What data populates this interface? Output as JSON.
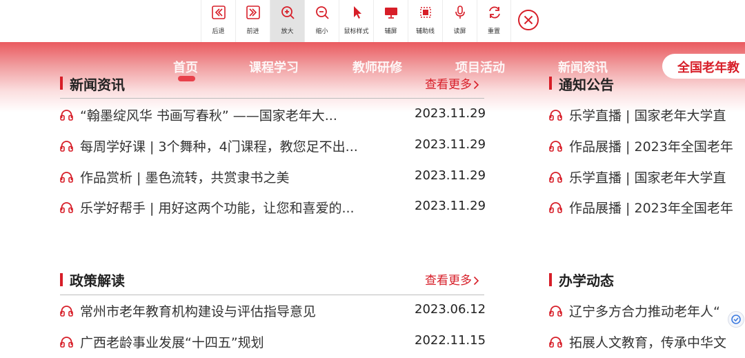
{
  "toolbar": {
    "buttons": [
      {
        "label": "后退",
        "icon": "back-icon"
      },
      {
        "label": "前进",
        "icon": "forward-icon"
      },
      {
        "label": "放大",
        "icon": "zoom-in-icon"
      },
      {
        "label": "缩小",
        "icon": "zoom-out-icon"
      },
      {
        "label": "鼠标样式",
        "icon": "cursor-icon"
      },
      {
        "label": "辅屏",
        "icon": "monitor-icon"
      },
      {
        "label": "辅助线",
        "icon": "guideline-icon"
      },
      {
        "label": "读屏",
        "icon": "microphone-icon"
      },
      {
        "label": "重置",
        "icon": "reset-icon"
      }
    ],
    "close_icon": "close-icon",
    "active_button": "放大"
  },
  "nav": {
    "items": [
      "首页",
      "课程学习",
      "教师研修",
      "项目活动",
      "新闻资讯"
    ],
    "active": "首页",
    "highlight": "全国老年教"
  },
  "sections": {
    "news": {
      "title": "新闻资讯",
      "more": "查看更多",
      "items": [
        {
          "title": "“翰墨绽风华 书画写春秋” ——国家老年大...",
          "date": "2023.11.29"
        },
        {
          "title": "每周学好课 | 3个舞种，4门课程，教您足不出...",
          "date": "2023.11.29"
        },
        {
          "title": "作品赏析 | 墨色流转，共赏隶书之美",
          "date": "2023.11.29"
        },
        {
          "title": "乐学好帮手 | 用好这两个功能，让您和喜爱的...",
          "date": "2023.11.29"
        }
      ]
    },
    "notice": {
      "title": "通知公告",
      "items": [
        {
          "title": "乐学直播 | 国家老年大学直"
        },
        {
          "title": "作品展播 | 2023年全国老年"
        },
        {
          "title": "乐学直播 | 国家老年大学直"
        },
        {
          "title": "作品展播 | 2023年全国老年"
        }
      ]
    },
    "policy": {
      "title": "政策解读",
      "more": "查看更多",
      "items": [
        {
          "title": "常州市老年教育机构建设与评估指导意见",
          "date": "2023.06.12"
        },
        {
          "title": "广西老龄事业发展“十四五”规划",
          "date": "2022.11.15"
        }
      ]
    },
    "school": {
      "title": "办学动态",
      "items": [
        {
          "title": "辽宁多方合力推动老年人“"
        },
        {
          "title": "拓展人文教育，传承中华文"
        }
      ]
    }
  },
  "colors": {
    "accent": "#d71e28",
    "band_top": "#ea5a5f",
    "active_button_bg": "#e3e3e3"
  }
}
